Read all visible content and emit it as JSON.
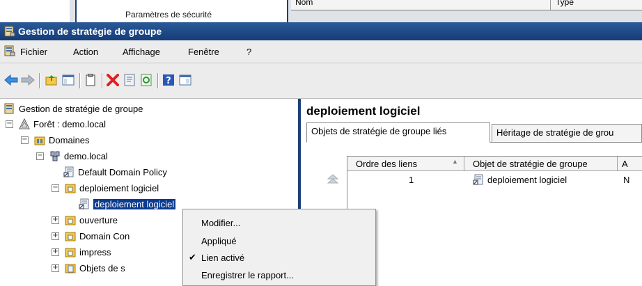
{
  "background_window": {
    "column_name": "Nom",
    "column_type": "Type",
    "peek_text": "Paramètres de sécurité"
  },
  "window": {
    "title": "Gestion de stratégie de groupe",
    "title_bar_color": "#1f4a8a"
  },
  "menubar": {
    "items": [
      "Fichier",
      "Action",
      "Affichage",
      "Fenêtre",
      "?"
    ]
  },
  "toolbar": {
    "buttons": [
      "back-icon",
      "forward-icon",
      "up-folder-icon",
      "show-hide-tree-icon",
      "copy-icon",
      "delete-icon",
      "properties-icon",
      "refresh-icon",
      "help-icon",
      "console-icon"
    ]
  },
  "tree": {
    "root": "Gestion de stratégie de groupe",
    "forest": "Forêt : demo.local",
    "domains": "Domaines",
    "domain": "demo.local",
    "default_policy": "Default Domain Policy",
    "ou_deploiement": "deploiement logiciel",
    "gpo_link": "deploiement logiciel",
    "ou_ouverture": "ouverture",
    "ou_domain_controllers": "Domain Con",
    "ou_impress": "impress",
    "gpo_objects": "Objets de s"
  },
  "details": {
    "title": "deploiement logiciel",
    "tabs": [
      "Objets de stratégie de groupe liés",
      "Héritage de stratégie de grou"
    ],
    "columns": [
      "Ordre des liens",
      "Objet de stratégie de groupe",
      "A"
    ],
    "rows": [
      {
        "order": "1",
        "gpo": "deploiement logiciel",
        "flag": "N"
      }
    ]
  },
  "context_menu": {
    "items": [
      {
        "label": "Modifier...",
        "checked": false
      },
      {
        "label": "Appliqué",
        "checked": false
      },
      {
        "label": "Lien activé",
        "checked": true
      },
      {
        "label": "Enregistrer le rapport...",
        "checked": false
      }
    ]
  }
}
